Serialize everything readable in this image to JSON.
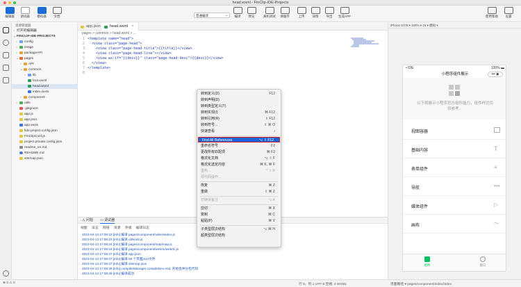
{
  "window": {
    "title": "head.wxml - FinClip-IDE-Projects"
  },
  "toolbar": {
    "left": [
      "编辑器",
      "调试器",
      "模拟器",
      "文档"
    ],
    "mode_select": "普通编译",
    "center": [
      "编译",
      "预览"
    ],
    "right": [
      "真机调试",
      "清缓存",
      "上传",
      "详情",
      "导出",
      "生成APP"
    ],
    "far_right": [
      "使用帮助",
      "设置"
    ]
  },
  "explorer": {
    "header": "资源管理器",
    "open_editors": "打开的编辑器",
    "project": "FINCLIP-IDE-PROJECTS",
    "items": [
      {
        "label": "config",
        "type": "folder"
      },
      {
        "label": "image",
        "type": "folder"
      },
      {
        "label": "packageAPI",
        "type": "folder"
      },
      {
        "label": "pages",
        "type": "folder"
      },
      {
        "label": "API",
        "type": "folder"
      },
      {
        "label": "common",
        "type": "folder"
      },
      {
        "label": "lib",
        "type": "folder"
      },
      {
        "label": "foot.wxml",
        "type": "file"
      },
      {
        "label": "head.wxml",
        "type": "file"
      },
      {
        "label": "index.wxss",
        "type": "file"
      },
      {
        "label": "component",
        "type": "folder"
      },
      {
        "label": "utils",
        "type": "folder"
      },
      {
        "label": ".gitignore",
        "type": "file"
      },
      {
        "label": "app.js",
        "type": "file"
      },
      {
        "label": "app.json",
        "type": "file"
      },
      {
        "label": "app.wxss",
        "type": "file"
      },
      {
        "label": "fide.project.config.json",
        "type": "file"
      },
      {
        "label": "FinClipConf.js",
        "type": "file"
      },
      {
        "label": "project.private.config.json",
        "type": "file"
      },
      {
        "label": "readme_en.md",
        "type": "file"
      },
      {
        "label": "README.md",
        "type": "file"
      },
      {
        "label": "sitemap.json",
        "type": "file"
      }
    ]
  },
  "editor": {
    "tabs": [
      {
        "label": "app.json"
      },
      {
        "label": "head.wxml"
      }
    ],
    "breadcrumb": "pages > common > head.wxml > ...",
    "code_lines": [
      "<template name=\"head\">",
      "  <view class=\"page-head\">",
      "    <view class=\"page-head-title\">{{title}}</view>",
      "    <view class=\"page-head-line\"></view>",
      "    <view wx:if=\"{{desc}}\" class=\"page-head-desc\">{{desc}}</view>",
      "  </view>",
      "</template>",
      ""
    ],
    "line_numbers": [
      "1",
      "2",
      "3",
      "4",
      "5",
      "6",
      "7",
      "8"
    ]
  },
  "context_menu": {
    "items": [
      {
        "label": "转到定义(D)",
        "shortcut": "F12"
      },
      {
        "label": "转到声明(D)",
        "shortcut": ""
      },
      {
        "label": "转到类型定义(T)",
        "shortcut": ""
      },
      {
        "label": "转到实现(I)",
        "shortcut": "⌘ F12"
      },
      {
        "label": "转到引用(R)",
        "shortcut": "⇧ F12"
      },
      {
        "label": "转到符号...",
        "shortcut": "⇧ ⌘ O"
      },
      {
        "label": "快速查看",
        "shortcut": "›"
      },
      {
        "label": "Find All References",
        "shortcut": "⌥ ⇧ F12",
        "highlight": true
      },
      {
        "label": "重命名符号",
        "shortcut": "F2"
      },
      {
        "label": "更改所有匹配项",
        "shortcut": "⌘ F2"
      },
      {
        "label": "格式化文档",
        "shortcut": "⌥ ⇧ F"
      },
      {
        "label": "格式化选定内容",
        "shortcut": "⌘ K, ⌘ F"
      },
      {
        "label": "重构...",
        "shortcut": "^ ⇧ R",
        "disabled": true
      },
      {
        "label": "源代码操作...",
        "shortcut": "",
        "disabled": true
      },
      {
        "label": "恢复",
        "shortcut": "⌘ Z"
      },
      {
        "label": "重做",
        "shortcut": "⇧ ⌘ Z"
      },
      {
        "label": "切换块备注",
        "shortcut": "⌥ A",
        "disabled": true
      },
      {
        "label": "剪切",
        "shortcut": "⌘ X"
      },
      {
        "label": "复制",
        "shortcut": "⌘ C"
      },
      {
        "label": "粘贴(P)",
        "shortcut": "⌘ V"
      },
      {
        "label": "子类型层次结构",
        "shortcut": "⌥ ⌘ H"
      },
      {
        "label": "超类型层次结构",
        "shortcut": ""
      }
    ]
  },
  "panel": {
    "tabs": [
      "问题",
      "调试器"
    ],
    "devtools_tabs": [
      "视图",
      "日志",
      "网络",
      "资源",
      "存储",
      "编译日志"
    ],
    "logs": [
      "2023-04-13 17:08:22 [info] 编译 pages/component/video/video.js",
      "2023-04-13 17:08:23 [info] 编译 utils/util.js",
      "2023-04-13 17:08:24 [info] 编译 pages/component/map/map.js",
      "2023-04-13 17:08:24 [info] 编译 pages/component/webrtc/webrtc.js",
      "2023-04-13 17:08:27 [info] 编译 app.json",
      "2023-04-13 17:08:27 [info] 编译 65 个页面json文件",
      "2023-04-13 17:08:27 [info] 编译 sitemap.json",
      "2023-04-13 17:08:28 [info] compilerManager.compileDev end, 开始合并分包代码",
      "2023-04-13 17:08:29 [info] 编译成功"
    ]
  },
  "simulator": {
    "device_bar": "iPhone 6/7/8 ▾   100% ▾   16 ▾   模拟 ▾",
    "status_carrier": "• IDE",
    "status_battery": "100% ▬",
    "nav_title": "小程序组件展示",
    "capsule": "••• ◉",
    "hero_desc": "以下将展示小程序官方组件能力，组件样式仅供参考。",
    "menu": [
      "视图容器",
      "基础内容",
      "表单组件",
      "导航",
      "媒体组件",
      "画布"
    ],
    "tabbar": [
      "组件",
      "接口"
    ],
    "accent": "#07c160"
  },
  "statusbar": {
    "left": "⊗ 0 ⚠ 0",
    "position": "行 8，列 1   UTF-8   空格: 4   WXML",
    "sim_path": "页面路径 ▾   pages/component/index/index"
  }
}
